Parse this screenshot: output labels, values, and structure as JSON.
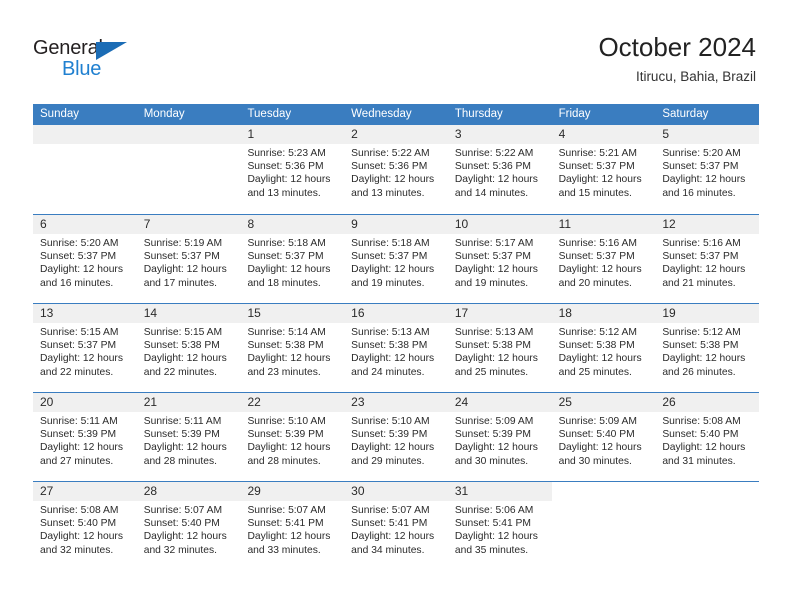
{
  "brand": {
    "name_top": "General",
    "name_bottom": "Blue",
    "triangle_color": "#1b6cb5",
    "blue_color": "#2080d0"
  },
  "header": {
    "title": "October 2024",
    "subtitle": "Itirucu, Bahia, Brazil"
  },
  "theme": {
    "header_blue": "#3a7dc0",
    "day_band_gray": "#f0f0f0",
    "text": "#2b2b2b"
  },
  "weekdays": [
    "Sunday",
    "Monday",
    "Tuesday",
    "Wednesday",
    "Thursday",
    "Friday",
    "Saturday"
  ],
  "labels": {
    "sunrise_prefix": "Sunrise:",
    "sunset_prefix": "Sunset:",
    "daylight_prefix": "Daylight:"
  },
  "weeks": [
    [
      {
        "day": "",
        "empty": true
      },
      {
        "day": "",
        "empty": true
      },
      {
        "day": "1",
        "sunrise": "Sunrise: 5:23 AM",
        "sunset": "Sunset: 5:36 PM",
        "daylight1": "Daylight: 12 hours",
        "daylight2": "and 13 minutes."
      },
      {
        "day": "2",
        "sunrise": "Sunrise: 5:22 AM",
        "sunset": "Sunset: 5:36 PM",
        "daylight1": "Daylight: 12 hours",
        "daylight2": "and 13 minutes."
      },
      {
        "day": "3",
        "sunrise": "Sunrise: 5:22 AM",
        "sunset": "Sunset: 5:36 PM",
        "daylight1": "Daylight: 12 hours",
        "daylight2": "and 14 minutes."
      },
      {
        "day": "4",
        "sunrise": "Sunrise: 5:21 AM",
        "sunset": "Sunset: 5:37 PM",
        "daylight1": "Daylight: 12 hours",
        "daylight2": "and 15 minutes."
      },
      {
        "day": "5",
        "sunrise": "Sunrise: 5:20 AM",
        "sunset": "Sunset: 5:37 PM",
        "daylight1": "Daylight: 12 hours",
        "daylight2": "and 16 minutes."
      }
    ],
    [
      {
        "day": "6",
        "sunrise": "Sunrise: 5:20 AM",
        "sunset": "Sunset: 5:37 PM",
        "daylight1": "Daylight: 12 hours",
        "daylight2": "and 16 minutes."
      },
      {
        "day": "7",
        "sunrise": "Sunrise: 5:19 AM",
        "sunset": "Sunset: 5:37 PM",
        "daylight1": "Daylight: 12 hours",
        "daylight2": "and 17 minutes."
      },
      {
        "day": "8",
        "sunrise": "Sunrise: 5:18 AM",
        "sunset": "Sunset: 5:37 PM",
        "daylight1": "Daylight: 12 hours",
        "daylight2": "and 18 minutes."
      },
      {
        "day": "9",
        "sunrise": "Sunrise: 5:18 AM",
        "sunset": "Sunset: 5:37 PM",
        "daylight1": "Daylight: 12 hours",
        "daylight2": "and 19 minutes."
      },
      {
        "day": "10",
        "sunrise": "Sunrise: 5:17 AM",
        "sunset": "Sunset: 5:37 PM",
        "daylight1": "Daylight: 12 hours",
        "daylight2": "and 19 minutes."
      },
      {
        "day": "11",
        "sunrise": "Sunrise: 5:16 AM",
        "sunset": "Sunset: 5:37 PM",
        "daylight1": "Daylight: 12 hours",
        "daylight2": "and 20 minutes."
      },
      {
        "day": "12",
        "sunrise": "Sunrise: 5:16 AM",
        "sunset": "Sunset: 5:37 PM",
        "daylight1": "Daylight: 12 hours",
        "daylight2": "and 21 minutes."
      }
    ],
    [
      {
        "day": "13",
        "sunrise": "Sunrise: 5:15 AM",
        "sunset": "Sunset: 5:37 PM",
        "daylight1": "Daylight: 12 hours",
        "daylight2": "and 22 minutes."
      },
      {
        "day": "14",
        "sunrise": "Sunrise: 5:15 AM",
        "sunset": "Sunset: 5:38 PM",
        "daylight1": "Daylight: 12 hours",
        "daylight2": "and 22 minutes."
      },
      {
        "day": "15",
        "sunrise": "Sunrise: 5:14 AM",
        "sunset": "Sunset: 5:38 PM",
        "daylight1": "Daylight: 12 hours",
        "daylight2": "and 23 minutes."
      },
      {
        "day": "16",
        "sunrise": "Sunrise: 5:13 AM",
        "sunset": "Sunset: 5:38 PM",
        "daylight1": "Daylight: 12 hours",
        "daylight2": "and 24 minutes."
      },
      {
        "day": "17",
        "sunrise": "Sunrise: 5:13 AM",
        "sunset": "Sunset: 5:38 PM",
        "daylight1": "Daylight: 12 hours",
        "daylight2": "and 25 minutes."
      },
      {
        "day": "18",
        "sunrise": "Sunrise: 5:12 AM",
        "sunset": "Sunset: 5:38 PM",
        "daylight1": "Daylight: 12 hours",
        "daylight2": "and 25 minutes."
      },
      {
        "day": "19",
        "sunrise": "Sunrise: 5:12 AM",
        "sunset": "Sunset: 5:38 PM",
        "daylight1": "Daylight: 12 hours",
        "daylight2": "and 26 minutes."
      }
    ],
    [
      {
        "day": "20",
        "sunrise": "Sunrise: 5:11 AM",
        "sunset": "Sunset: 5:39 PM",
        "daylight1": "Daylight: 12 hours",
        "daylight2": "and 27 minutes."
      },
      {
        "day": "21",
        "sunrise": "Sunrise: 5:11 AM",
        "sunset": "Sunset: 5:39 PM",
        "daylight1": "Daylight: 12 hours",
        "daylight2": "and 28 minutes."
      },
      {
        "day": "22",
        "sunrise": "Sunrise: 5:10 AM",
        "sunset": "Sunset: 5:39 PM",
        "daylight1": "Daylight: 12 hours",
        "daylight2": "and 28 minutes."
      },
      {
        "day": "23",
        "sunrise": "Sunrise: 5:10 AM",
        "sunset": "Sunset: 5:39 PM",
        "daylight1": "Daylight: 12 hours",
        "daylight2": "and 29 minutes."
      },
      {
        "day": "24",
        "sunrise": "Sunrise: 5:09 AM",
        "sunset": "Sunset: 5:39 PM",
        "daylight1": "Daylight: 12 hours",
        "daylight2": "and 30 minutes."
      },
      {
        "day": "25",
        "sunrise": "Sunrise: 5:09 AM",
        "sunset": "Sunset: 5:40 PM",
        "daylight1": "Daylight: 12 hours",
        "daylight2": "and 30 minutes."
      },
      {
        "day": "26",
        "sunrise": "Sunrise: 5:08 AM",
        "sunset": "Sunset: 5:40 PM",
        "daylight1": "Daylight: 12 hours",
        "daylight2": "and 31 minutes."
      }
    ],
    [
      {
        "day": "27",
        "sunrise": "Sunrise: 5:08 AM",
        "sunset": "Sunset: 5:40 PM",
        "daylight1": "Daylight: 12 hours",
        "daylight2": "and 32 minutes."
      },
      {
        "day": "28",
        "sunrise": "Sunrise: 5:07 AM",
        "sunset": "Sunset: 5:40 PM",
        "daylight1": "Daylight: 12 hours",
        "daylight2": "and 32 minutes."
      },
      {
        "day": "29",
        "sunrise": "Sunrise: 5:07 AM",
        "sunset": "Sunset: 5:41 PM",
        "daylight1": "Daylight: 12 hours",
        "daylight2": "and 33 minutes."
      },
      {
        "day": "30",
        "sunrise": "Sunrise: 5:07 AM",
        "sunset": "Sunset: 5:41 PM",
        "daylight1": "Daylight: 12 hours",
        "daylight2": "and 34 minutes."
      },
      {
        "day": "31",
        "sunrise": "Sunrise: 5:06 AM",
        "sunset": "Sunset: 5:41 PM",
        "daylight1": "Daylight: 12 hours",
        "daylight2": "and 35 minutes."
      },
      {
        "day": "",
        "empty": true,
        "blank": true
      },
      {
        "day": "",
        "empty": true,
        "blank": true
      }
    ]
  ]
}
